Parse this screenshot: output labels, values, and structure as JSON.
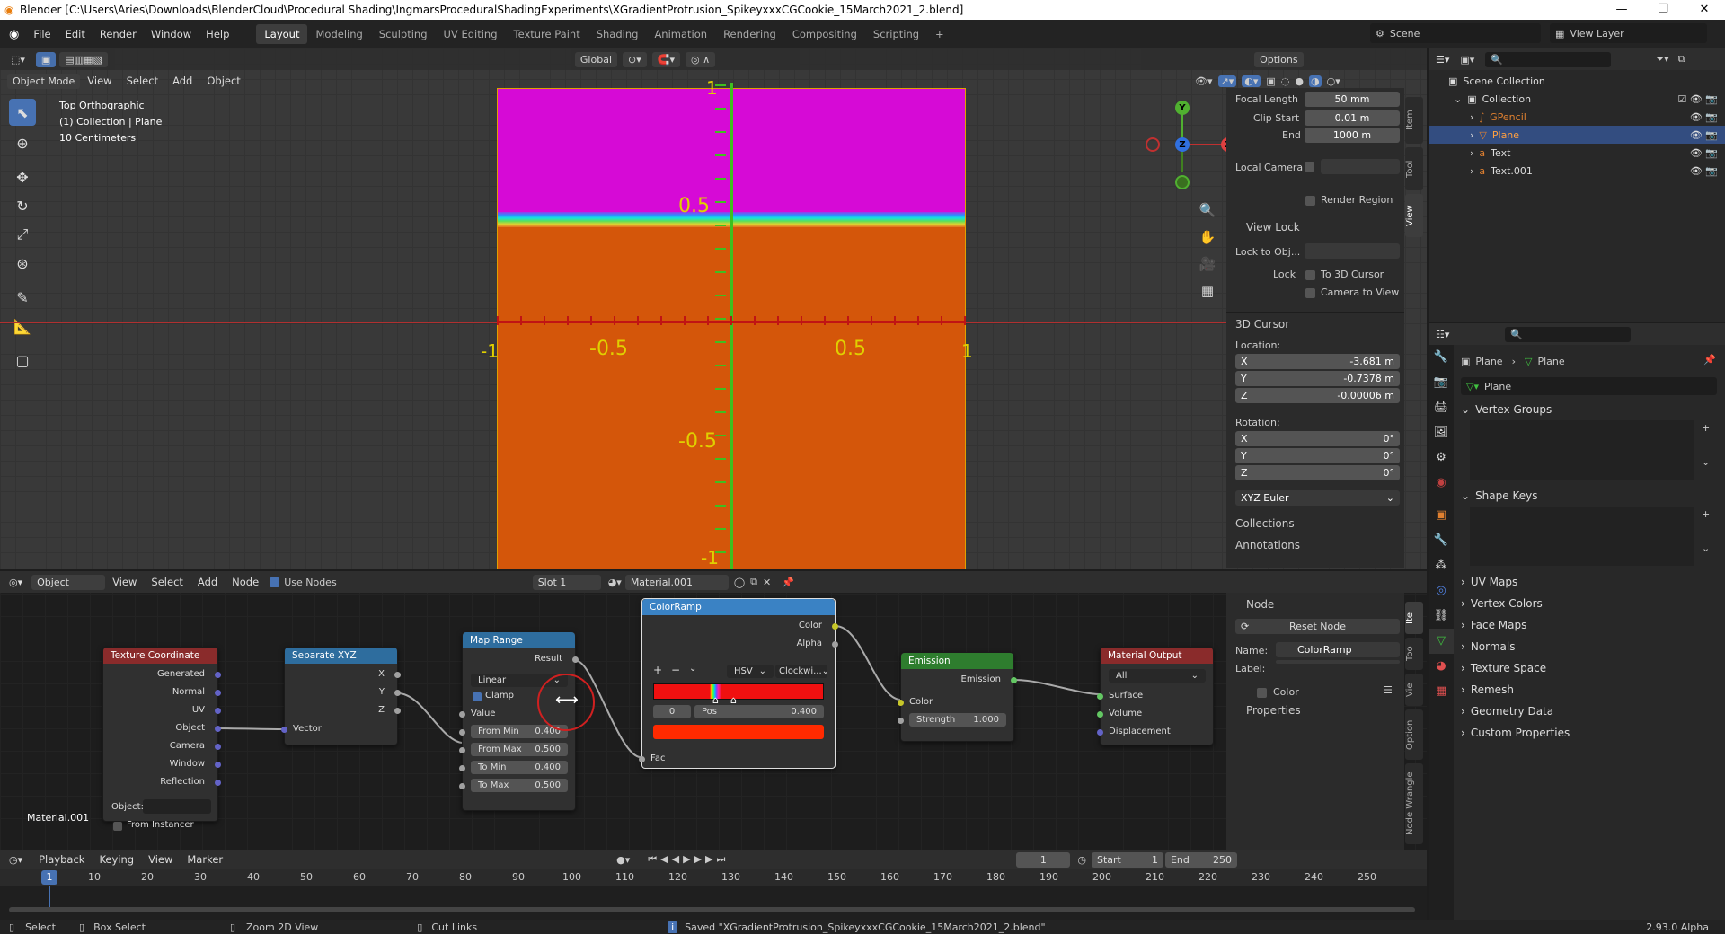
{
  "window": {
    "title": "Blender [C:\\Users\\Aries\\Downloads\\BlenderCloud\\Procedural Shading\\IngmarsProceduralShadingExperiments\\XGradientProtrusion_SpikeyxxxCGCookie_15March2021_2.blend]",
    "minimize": "—",
    "maximize": "❐",
    "close": "✕"
  },
  "menu": [
    "File",
    "Edit",
    "Render",
    "Window",
    "Help"
  ],
  "workspaces": [
    "Layout",
    "Modeling",
    "Sculpting",
    "UV Editing",
    "Texture Paint",
    "Shading",
    "Animation",
    "Rendering",
    "Compositing",
    "Scripting"
  ],
  "active_workspace": "Layout",
  "scene": {
    "label": "Scene",
    "view_layer": "View Layer"
  },
  "viewport_header": {
    "transform": "Global",
    "options": "Options"
  },
  "viewport_menu": {
    "mode": "Object Mode",
    "items": [
      "View",
      "Select",
      "Add",
      "Object"
    ]
  },
  "viewport_info": {
    "line1": "Top Orthographic",
    "line2": "(1) Collection | Plane",
    "line3": "10 Centimeters"
  },
  "viewport_tab_labels": [
    "Item",
    "Tool",
    "View"
  ],
  "axis_labels": {
    "y_top": "1",
    "y_half": "0.5",
    "y_neg_half": "-0.5",
    "y_bottom": "-1",
    "x_left": "-1",
    "x_neg_half": "-0.5",
    "x_half": "0.5",
    "x_right": "1"
  },
  "gizmo": {
    "x": "X",
    "y": "Y",
    "z": "Z"
  },
  "view_panel": {
    "focal_length_label": "Focal Length",
    "focal_length": "50 mm",
    "clip_start_label": "Clip Start",
    "clip_start": "0.01 m",
    "end_label": "End",
    "end": "1000 m",
    "local_camera_label": "Local Camera",
    "render_region": "Render Region",
    "view_lock": "View Lock",
    "lock_to_obj": "Lock to Obj...",
    "lock_label": "Lock",
    "to_3d_cursor": "To 3D Cursor",
    "camera_to_view": "Camera to View"
  },
  "cursor_panel": {
    "title": "3D Cursor",
    "location_label": "Location:",
    "loc": [
      {
        "axis": "X",
        "value": "-3.681 m"
      },
      {
        "axis": "Y",
        "value": "-0.7378 m"
      },
      {
        "axis": "Z",
        "value": "-0.00006 m"
      }
    ],
    "rotation_label": "Rotation:",
    "rot": [
      {
        "axis": "X",
        "value": "0°"
      },
      {
        "axis": "Y",
        "value": "0°"
      },
      {
        "axis": "Z",
        "value": "0°"
      }
    ],
    "rotation_mode": "XYZ Euler",
    "collections": "Collections",
    "annotations": "Annotations"
  },
  "outliner": {
    "root": "Scene Collection",
    "collection": "Collection",
    "items": [
      {
        "name": "GPencil"
      },
      {
        "name": "Plane"
      },
      {
        "name": "Text"
      },
      {
        "name": "Text.001"
      }
    ]
  },
  "properties": {
    "object_name": "Plane",
    "mesh_name": "Plane",
    "data_name": "Plane",
    "sections": [
      "Vertex Groups",
      "Shape Keys",
      "UV Maps",
      "Vertex Colors",
      "Face Maps",
      "Normals",
      "Texture Space",
      "Remesh",
      "Geometry Data",
      "Custom Properties"
    ]
  },
  "node_header": {
    "editor_type": "Object",
    "items": [
      "View",
      "Select",
      "Add",
      "Node"
    ],
    "use_nodes": "Use Nodes",
    "slot": "Slot 1",
    "material": "Material.001"
  },
  "node_tab_labels": [
    "Ite",
    "Too",
    "Vie",
    "Option",
    "Node Wrangle"
  ],
  "node_panel": {
    "title": "Node",
    "reset": "Reset Node",
    "name_label": "Name:",
    "name": "ColorRamp",
    "label_label": "Label:",
    "color": "Color",
    "properties": "Properties"
  },
  "material_label": "Material.001",
  "nodes": {
    "tex_coord": {
      "title": "Texture Coordinate",
      "outputs": [
        "Generated",
        "Normal",
        "UV",
        "Object",
        "Camera",
        "Window",
        "Reflection"
      ],
      "object_label": "Object:",
      "from_instancer": "From Instancer"
    },
    "sep_xyz": {
      "title": "Separate XYZ",
      "outputs": [
        "X",
        "Y",
        "Z"
      ],
      "input": "Vector"
    },
    "map_range": {
      "title": "Map Range",
      "output": "Result",
      "interp": "Linear",
      "clamp": "Clamp",
      "value": "Value",
      "fields": [
        {
          "label": "From Min",
          "value": "0.400"
        },
        {
          "label": "From Max",
          "value": "0.500"
        },
        {
          "label": "To Min",
          "value": "0.400"
        },
        {
          "label": "To Max",
          "value": "0.500"
        }
      ]
    },
    "color_ramp": {
      "title": "ColorRamp",
      "outputs": [
        "Color",
        "Alpha"
      ],
      "mode": "HSV",
      "hue": "Clockwi...",
      "index": "0",
      "pos_label": "Pos",
      "pos": "0.400",
      "input": "Fac"
    },
    "emission": {
      "title": "Emission",
      "output": "Emission",
      "color": "Color",
      "strength_label": "Strength",
      "strength": "1.000"
    },
    "mat_output": {
      "title": "Material Output",
      "target": "All",
      "inputs": [
        "Surface",
        "Volume",
        "Displacement"
      ]
    }
  },
  "timeline": {
    "menu": [
      "Playback",
      "Keying",
      "View",
      "Marker"
    ],
    "current": "1",
    "start_label": "Start",
    "start": "1",
    "end_label": "End",
    "end": "250",
    "ticks": [
      "10",
      "20",
      "30",
      "40",
      "50",
      "60",
      "70",
      "80",
      "90",
      "100",
      "110",
      "120",
      "130",
      "140",
      "150",
      "160",
      "170",
      "180",
      "190",
      "200",
      "210",
      "220",
      "230",
      "240",
      "250"
    ],
    "frame_marker": "1"
  },
  "status": {
    "select": "Select",
    "box_select": "Box Select",
    "zoom": "Zoom 2D View",
    "cut_links": "Cut Links",
    "message": "Saved \"XGradientProtrusion_SpikeyxxxCGCookie_15March2021_2.blend\"",
    "version": "2.93.0 Alpha"
  },
  "colors": {
    "magenta": "#d60ad6",
    "orange": "#d4560a",
    "green_axis": "#3fbf1f",
    "red_axis": "#c01414",
    "accent": "#4772b3"
  }
}
